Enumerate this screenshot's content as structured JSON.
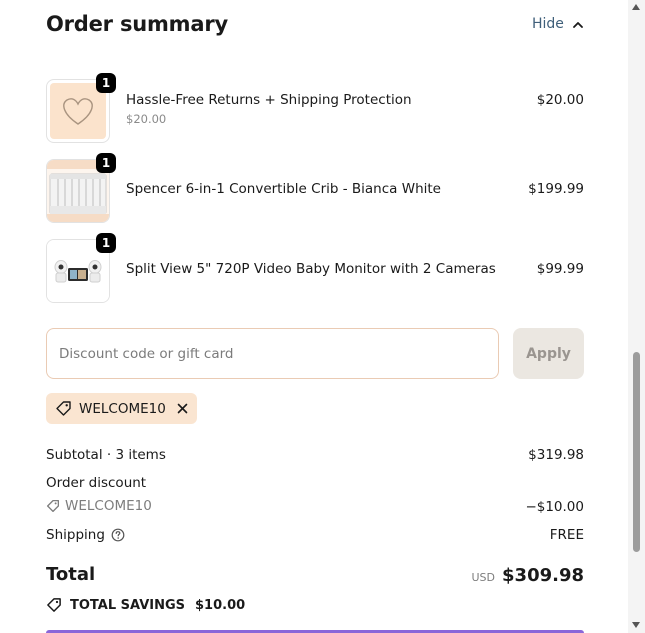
{
  "summary": {
    "title": "Order summary",
    "toggle_label": "Hide"
  },
  "items": [
    {
      "name": "Hassle-Free Returns + Shipping Protection",
      "sub_price": "$20.00",
      "price": "$20.00",
      "qty": "1",
      "thumb_icon": "heart-icon"
    },
    {
      "name": "Spencer 6-in-1 Convertible Crib - Bianca White",
      "price": "$199.99",
      "qty": "1",
      "thumb_icon": "crib-image"
    },
    {
      "name": "Split View 5\" 720P Video Baby Monitor with 2 Cameras",
      "price": "$99.99",
      "qty": "1",
      "thumb_icon": "baby-monitor-image"
    }
  ],
  "discount": {
    "placeholder": "Discount code or gift card",
    "value": "",
    "apply_label": "Apply",
    "applied_code": "WELCOME10"
  },
  "totals": {
    "subtotal_label": "Subtotal · 3 items",
    "subtotal_value": "$319.98",
    "order_discount_label": "Order discount",
    "discount_code": "WELCOME10",
    "discount_value": "−$10.00",
    "shipping_label": "Shipping",
    "shipping_value": "FREE",
    "total_label": "Total",
    "currency": "USD",
    "total_value": "$309.98",
    "savings_label": "TOTAL SAVINGS",
    "savings_value": "$10.00"
  },
  "colors": {
    "accent_text": "#3f5f7a",
    "chip_bg": "#fae5d1",
    "input_border": "#eacbb4",
    "apply_bg": "#ebe7e1",
    "bottom_accent": "#8a66d9"
  }
}
